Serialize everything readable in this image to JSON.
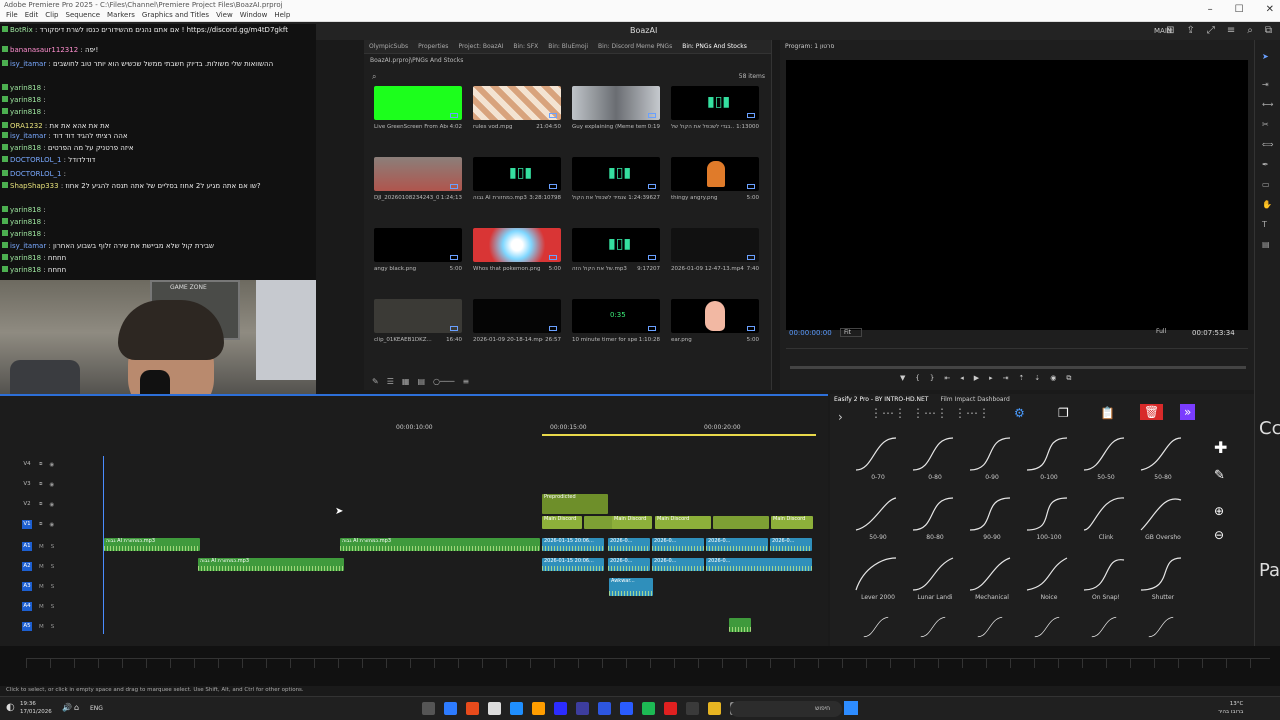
{
  "window": {
    "path": "Adobe Premiere Pro 2025 - C:\\Files\\Channel\\Premiere Project Files\\BoazAI.prproj",
    "menu": [
      "File",
      "Edit",
      "Clip",
      "Sequence",
      "Markers",
      "Graphics and Titles",
      "View",
      "Window",
      "Help"
    ],
    "app_title": "BoazAI",
    "workspace": "MAIN"
  },
  "chat": [
    {
      "user": "BotRix",
      "msg": "אם אתם נהנים מהשידורים כנסו לשרת דיסקורד ! https://discord.gg/m4tD7gkft",
      "color": "green"
    },
    {
      "user": "bananasaur112312",
      "msg": "יפה!",
      "color": "pink"
    },
    {
      "user": "isy_itamar",
      "msg": "ההשוואות שלי משולות. בדיוק חשבתי ממשל שכשיש הוא יותר טוב לחושבים",
      "color": "blue"
    },
    {
      "user": "yarin818",
      "msg": "",
      "color": "green"
    },
    {
      "user": "yarin818",
      "msg": "",
      "color": "green"
    },
    {
      "user": "yarin818",
      "msg": "",
      "color": "green"
    },
    {
      "user": "ORA1232",
      "msg": "את את אהא את את",
      "color": "yellow"
    },
    {
      "user": "isy_itamar",
      "msg": "אהה רציתי להגיד דוד דוד",
      "color": "blue"
    },
    {
      "user": "yarin818",
      "msg": "איזה פרטניק על מה הפרטים",
      "color": "green"
    },
    {
      "user": "DOCTORLOL_1",
      "msg": "דודלדודל",
      "color": "blue"
    },
    {
      "user": "DOCTORLOL_1",
      "msg": "",
      "color": "blue"
    },
    {
      "user": "ShapShap333",
      "msg": "שו אם אתה מגיע ל2 אחוז בסליים של אתה תנסה להגיע ל2 אחוז?",
      "color": "yellow"
    },
    {
      "user": "yarin818",
      "msg": "",
      "color": "green"
    },
    {
      "user": "yarin818",
      "msg": "",
      "color": "green"
    },
    {
      "user": "yarin818",
      "msg": "",
      "color": "green"
    },
    {
      "user": "isy_itamar",
      "msg": "שבירת קול שלא מביישת את שירה זלוף בשבוע האחרון",
      "color": "blue"
    },
    {
      "user": "yarin818",
      "msg": "חחחח",
      "color": "green"
    },
    {
      "user": "yarin818",
      "msg": "חחחח",
      "color": "green"
    }
  ],
  "webcam": {
    "poster_text": "GAME ZONE"
  },
  "project": {
    "tabs": [
      "OlympicSubs",
      "Properties",
      "Project: BoazAI",
      "Bin: SFX",
      "Bin: BluEmoji",
      "Bin: Discord Meme PNGs",
      "Bin: PNGs And Stocks"
    ],
    "active_tab": "Bin: PNGs And Stocks",
    "path": "BoazAI.prproj\\PNGs And Stocks",
    "count": "58 items",
    "items": [
      {
        "name": "Live GreenScreen From Abov...",
        "dur": "4:02",
        "kind": "green"
      },
      {
        "name": "rules vod.mpg",
        "dur": "21:04:50",
        "kind": "pattern"
      },
      {
        "name": "Guy explaining (Meme templ...",
        "dur": "0:19",
        "kind": "room"
      },
      {
        "name": "בגדי לשכפל את הקול של...",
        "dur": "1:13000",
        "kind": "audio"
      },
      {
        "name": "DJI_20260108234243_00...",
        "dur": "1:24;13",
        "kind": "face"
      },
      {
        "name": "גבוה AI כמחזורת.mp3",
        "dur": "3:28:10798",
        "kind": "audio"
      },
      {
        "name": "כשנמיד לשכפל את הקול.mp3",
        "dur": "1:24:39627",
        "kind": "audio"
      },
      {
        "name": "thingy angry.png",
        "dur": "5:00",
        "kind": "avatar"
      },
      {
        "name": "angy black.png",
        "dur": "5:00",
        "kind": "black"
      },
      {
        "name": "Whos that pokemon.png",
        "dur": "5:00",
        "kind": "burst"
      },
      {
        "name": "של את הקול הזה.mp3",
        "dur": "9:17207",
        "kind": "audio"
      },
      {
        "name": "2026-01-09 12-47-13.mp4",
        "dur": "7:40",
        "kind": "screen"
      },
      {
        "name": "clip_01KEAEB1DKZ...",
        "dur": "16:40",
        "kind": "ui"
      },
      {
        "name": "2026-01-09 20-18-14.mp4",
        "dur": "26:57",
        "kind": "dark"
      },
      {
        "name": "10 minute timer for speed...",
        "dur": "1:10:28",
        "kind": "timer"
      },
      {
        "name": "ear.png",
        "dur": "5:00",
        "kind": "ear"
      }
    ],
    "timer_text": "0:35"
  },
  "program": {
    "title": "Program: סרטון 1",
    "timecode_left": "00:00:00:00",
    "fit": "Fit",
    "quality": "Full",
    "timecode_right": "00:07:53:34"
  },
  "timeline": {
    "timecodes": [
      "00:00:10:00",
      "00:00:15:00",
      "00:00:20:00"
    ],
    "tracks": [
      "V4",
      "V3",
      "V2",
      "V1",
      "A1",
      "A2",
      "A3",
      "A4",
      "A5"
    ],
    "clips": {
      "pregame": "Preprodicted",
      "main_discord": "Main Discord",
      "audio_a": "גבוה AI כמחזורת.mp3",
      "dated": "2026-01-15 20:06...",
      "dated_short": "2026-0...",
      "awkward": "Awkwar..."
    }
  },
  "motion": {
    "tabs": [
      "Easify 2 Pro - BY INTRO-HD.NET",
      "Film Impact Dashboard"
    ],
    "presets": [
      "0-70",
      "0-80",
      "0-90",
      "0-100",
      "50-50",
      "50-80",
      "50-90",
      "80-80",
      "90-90",
      "100-100",
      "Clink",
      "GB Oversho",
      "Lever 2000",
      "Lunar Landi",
      "Mechanical",
      "Noice",
      "On Snap!",
      "Shutter"
    ]
  },
  "side_text": {
    "top": "Cc",
    "bottom": "Pa"
  },
  "status": "Click to select, or click in empty space and drag to marquee select. Use Shift, Alt, and Ctrl for other options.",
  "taskbar": {
    "time": "19:36",
    "date": "17/01/2026",
    "lang": "ENG",
    "search": "חיפוש",
    "weather_temp": "13°C",
    "weather_desc": "ברובו בהיר"
  }
}
